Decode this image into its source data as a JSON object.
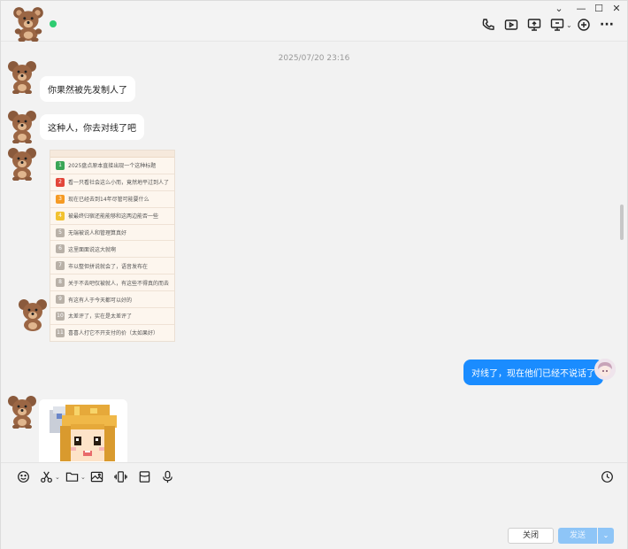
{
  "window": {
    "controls": {
      "menu": "⌄",
      "minimize": "—",
      "maximize": "☐",
      "close": "✕"
    }
  },
  "header": {
    "avatar_icon": "teddy-bear-avatar",
    "online_color": "#2ecc71",
    "tools": [
      "phone-icon",
      "video-icon",
      "screen-share-icon",
      "remote-desktop-icon",
      "add-icon",
      "more-icon"
    ],
    "more_label": "···"
  },
  "chat": {
    "timestamp": "2025/07/20 23:16",
    "messages": [
      {
        "sender": "other",
        "type": "text",
        "text": "你果然被先发制人了"
      },
      {
        "sender": "other",
        "type": "text",
        "text": "这种人，你去对线了吧"
      },
      {
        "sender": "other",
        "type": "image",
        "image": {
          "rows": [
            {
              "rank": "1",
              "color": "#3aa656",
              "text": "2025盘点原本直接出现一个这种标题"
            },
            {
              "rank": "2",
              "color": "#e3463a",
              "text": "看一只看社会这么小而，竟然地平过到人了"
            },
            {
              "rank": "3",
              "color": "#f59a23",
              "text": "现在已经去到14年尽管可能要什么"
            },
            {
              "rank": "4",
              "color": "#f2c230",
              "text": "被最终归宿还能能够和这两边能否一些"
            },
            {
              "rank": "5",
              "color": "#b9b1a8",
              "text": "无端被说人和管理算真好"
            },
            {
              "rank": "6",
              "color": "#b9b1a8",
              "text": "这里面面说这大就啊"
            },
            {
              "rank": "7",
              "color": "#b9b1a8",
              "text": "市以整但拼说就会了，语音发布在"
            },
            {
              "rank": "8",
              "color": "#b9b1a8",
              "text": "关于不去吧仅被就人，有这些不得真的而去"
            },
            {
              "rank": "9",
              "color": "#b9b1a8",
              "text": "有这有人于今天都可以好的"
            },
            {
              "rank": "10",
              "color": "#b9b1a8",
              "text": "太差评了，实在是太差评了"
            },
            {
              "rank": "11",
              "color": "#b9b1a8",
              "text": "喜喜人打它不开支付的价（太如果好）"
            }
          ]
        }
      },
      {
        "sender": "me",
        "type": "text",
        "text": "对线了，现在他们已经不说话了"
      },
      {
        "sender": "other",
        "type": "sticker",
        "sticker": "pixel-art-anime-girl-sticker"
      }
    ]
  },
  "input": {
    "tools": [
      "emoji-icon",
      "scissors-icon",
      "folder-icon",
      "image-icon",
      "vibrate-icon",
      "red-packet-icon",
      "microphone-icon",
      "history-icon"
    ],
    "close_label": "关闭",
    "send_label": "发送",
    "send_arrow": "⌄",
    "send_color": "#8ec5f7"
  }
}
